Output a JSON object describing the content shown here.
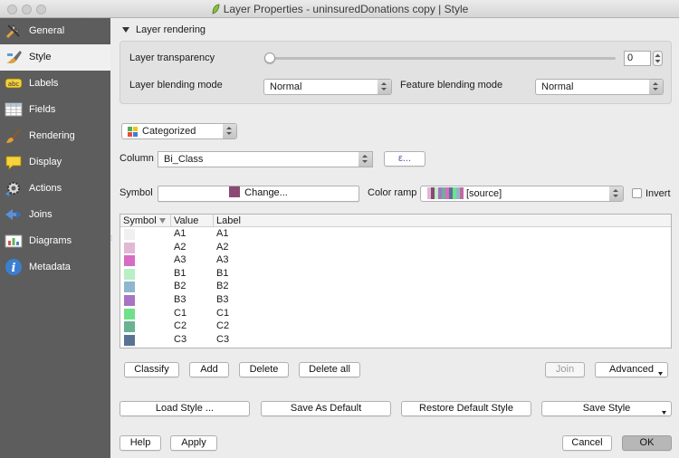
{
  "window": {
    "title": "Layer Properties - uninsuredDonations copy | Style"
  },
  "sidebar": {
    "items": [
      {
        "label": "General",
        "icon": "wrench-icon"
      },
      {
        "label": "Style",
        "icon": "paintbrush-icon"
      },
      {
        "label": "Labels",
        "icon": "labels-abc-icon"
      },
      {
        "label": "Fields",
        "icon": "table-icon"
      },
      {
        "label": "Rendering",
        "icon": "brush-icon"
      },
      {
        "label": "Display",
        "icon": "speech-bubble-icon"
      },
      {
        "label": "Actions",
        "icon": "gear-icon"
      },
      {
        "label": "Joins",
        "icon": "join-icon"
      },
      {
        "label": "Diagrams",
        "icon": "diagram-icon"
      },
      {
        "label": "Metadata",
        "icon": "info-icon"
      }
    ],
    "active": "Style"
  },
  "layer_rendering": {
    "header": "Layer rendering",
    "transparency_label": "Layer transparency",
    "transparency_value": "0",
    "transparency_fraction": 0,
    "blending_label": "Layer blending mode",
    "blending_value": "Normal",
    "feature_blending_label": "Feature blending mode",
    "feature_blending_value": "Normal"
  },
  "renderer": {
    "type": "Categorized"
  },
  "column": {
    "label": "Column",
    "value": "Bi_Class",
    "expr_button": "ε..."
  },
  "symbol": {
    "label": "Symbol",
    "change_label": "Change...",
    "color": "#8b4a73"
  },
  "color_ramp": {
    "label": "Color ramp",
    "value": "[source]",
    "invert_label": "Invert"
  },
  "categories": {
    "headers": {
      "symbol": "Symbol",
      "value": "Value",
      "label": "Label"
    },
    "rows": [
      {
        "color": "#f0f0f0",
        "value": "A1",
        "label": "A1"
      },
      {
        "color": "#e1b8d6",
        "value": "A2",
        "label": "A2"
      },
      {
        "color": "#d76cc2",
        "value": "A3",
        "label": "A3"
      },
      {
        "color": "#b9efc4",
        "value": "B1",
        "label": "B1"
      },
      {
        "color": "#8eb6cc",
        "value": "B2",
        "label": "B2"
      },
      {
        "color": "#a874c6",
        "value": "B3",
        "label": "B3"
      },
      {
        "color": "#70e08a",
        "value": "C1",
        "label": "C1"
      },
      {
        "color": "#6bb292",
        "value": "C2",
        "label": "C2"
      },
      {
        "color": "#5a7394",
        "value": "C3",
        "label": "C3"
      }
    ]
  },
  "actions": {
    "classify": "Classify",
    "add": "Add",
    "delete": "Delete",
    "delete_all": "Delete all",
    "join": "Join",
    "advanced": "Advanced"
  },
  "style_buttons": {
    "load": "Load Style ...",
    "save_default": "Save As Default",
    "restore": "Restore Default Style",
    "save": "Save Style"
  },
  "footer": {
    "help": "Help",
    "apply": "Apply",
    "cancel": "Cancel",
    "ok": "OK"
  }
}
